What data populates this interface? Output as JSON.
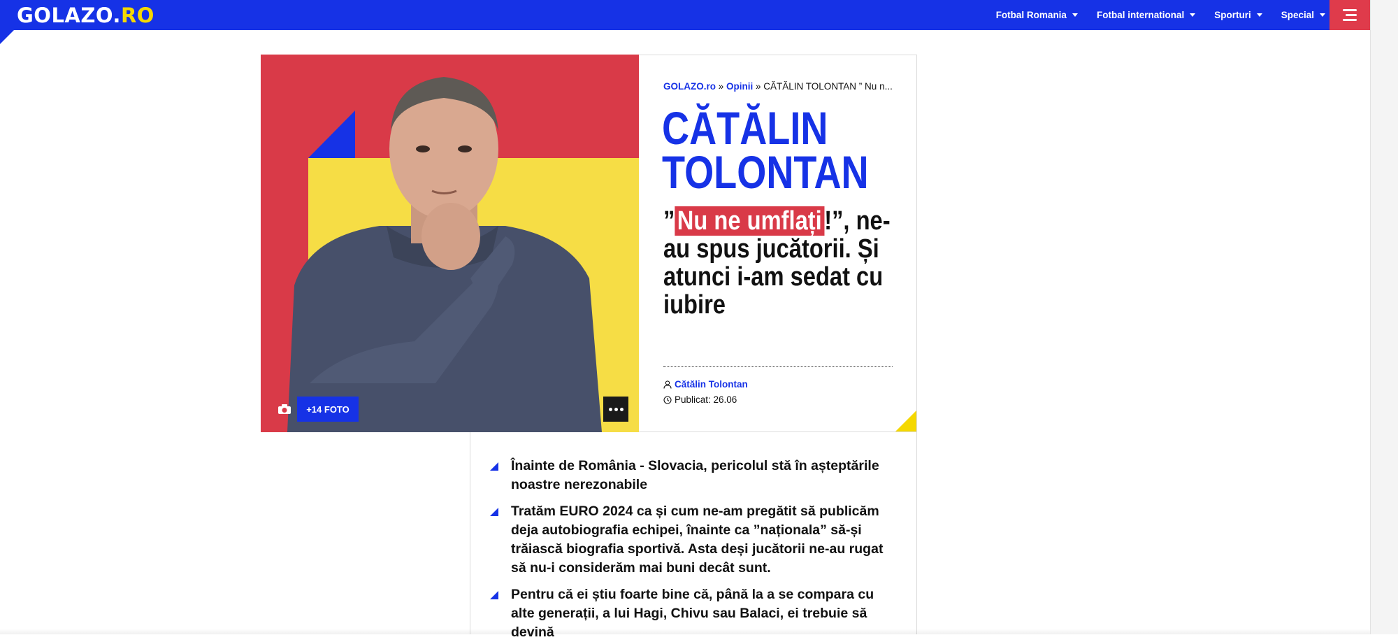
{
  "site": {
    "logo_main": "GOLAZO.",
    "logo_accent": "RO"
  },
  "nav": {
    "items": [
      {
        "label": "Fotbal Romania"
      },
      {
        "label": "Fotbal international"
      },
      {
        "label": "Sporturi"
      },
      {
        "label": "Special"
      }
    ],
    "menu_icon": "hamburger-icon"
  },
  "breadcrumb": {
    "home": "GOLAZO.ro",
    "sep1": " » ",
    "section": "Opinii",
    "sep2": " » ",
    "current": "CĂTĂLIN TOLONTAN ” Nu n..."
  },
  "article": {
    "author_line1": "CĂTĂLIN",
    "author_line2": "TOLONTAN",
    "headline_open": "”",
    "headline_highlight": "Nu ne umflați",
    "headline_rest": "!”, ne-au spus jucătorii. Și atunci i-am sedat cu iubire",
    "author": "Cătălin Tolontan",
    "published": "Publicat: 26.06"
  },
  "media": {
    "photo_count_label": "+14 FOTO",
    "camera_icon": "camera-icon",
    "more_icon": "ellipsis-icon"
  },
  "summary": {
    "bullets": [
      "Înainte de România - Slovacia, pericolul stă în așteptările noastre nerezonabile",
      "Tratăm EURO 2024 ca și cum ne-am pregătit să publicăm deja autobiografia echipei, înainte ca ”naționala” să-și trăiască biografia sportivă. Asta deși jucătorii ne-au rugat să nu-i considerăm mai buni decât sunt.",
      "Pentru că ei știu foarte bine că, până la a se compara cu alte generații, a lui Hagi, Chivu sau Balaci, ei trebuie să devină"
    ]
  },
  "colors": {
    "brand_blue": "#1632e6",
    "accent_red": "#d93a48",
    "accent_yellow": "#f5d800"
  }
}
